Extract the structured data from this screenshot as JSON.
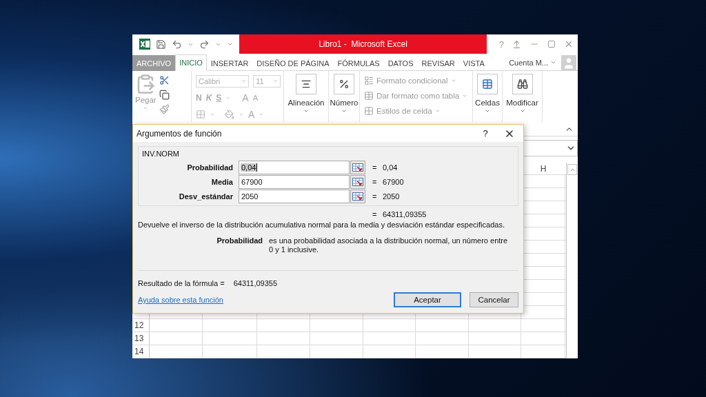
{
  "title_bar": {
    "title": "Libro1 -  Microsoft Excel",
    "help": "?"
  },
  "ribbon_tabs": [
    {
      "label": "ARCHIVO",
      "selected": false,
      "kind": "file"
    },
    {
      "label": "INICIO",
      "selected": true,
      "kind": "tab"
    },
    {
      "label": "INSERTAR",
      "selected": false,
      "kind": "tab"
    },
    {
      "label": "DISEÑO DE PÁGINA",
      "selected": false,
      "kind": "tab"
    },
    {
      "label": "FÓRMULAS",
      "selected": false,
      "kind": "tab"
    },
    {
      "label": "DATOS",
      "selected": false,
      "kind": "tab"
    },
    {
      "label": "REVISAR",
      "selected": false,
      "kind": "tab"
    },
    {
      "label": "VISTA",
      "selected": false,
      "kind": "tab"
    }
  ],
  "account": {
    "label": "Cuenta M..."
  },
  "ribbon": {
    "clipboard": {
      "paste": "Pegar"
    },
    "font": {
      "disabled": true,
      "name": "Calibri",
      "size": "11",
      "bold": "N",
      "italic": "K",
      "underline": "S",
      "grow": "A",
      "shrink": "A",
      "font_color_label": "A"
    },
    "big_buttons": [
      {
        "label": "Alineación",
        "kind": "align"
      },
      {
        "label": "Número",
        "kind": "number"
      }
    ],
    "styles": {
      "disabled": true,
      "items": [
        {
          "label": "Formato condicional",
          "kind": "conditional"
        },
        {
          "label": "Dar formato como tabla",
          "kind": "table"
        },
        {
          "label": "Estilos de celda",
          "kind": "cellstyle"
        }
      ]
    },
    "cells_buttons": [
      {
        "label": "Celdas",
        "kind": "cells"
      },
      {
        "label": "Modificar",
        "kind": "find"
      }
    ]
  },
  "sheet": {
    "column_header": "H",
    "row_numbers": [
      "12",
      "13",
      "14"
    ]
  },
  "dialog": {
    "title": "Argumentos de función",
    "help": "?",
    "function_name": "INV.NORM",
    "arguments": [
      {
        "label": "Probabilidad",
        "value": "0,04",
        "equals": "=",
        "result": "0,04",
        "selected": true
      },
      {
        "label": "Media",
        "value": "67900",
        "equals": "=",
        "result": "67900",
        "selected": false
      },
      {
        "label": "Desv_estándar",
        "value": "2050",
        "equals": "=",
        "result": "2050",
        "selected": false
      }
    ],
    "total": {
      "equals": "=",
      "value": "64311,09355"
    },
    "description": "Devuelve el inverso de la distribución acumulativa normal para la media y desviación estándar especificadas.",
    "argument_help": {
      "name": "Probabilidad",
      "text": "es una probabilidad asociada a la distribución normal, un número entre 0 y 1 inclusive."
    },
    "result_label": "Resultado de la fórmula =",
    "result_value": "64311,09355",
    "help_link": "Ayuda sobre esta función",
    "buttons": [
      {
        "label": "Aceptar",
        "default": true
      },
      {
        "label": "Cancelar",
        "default": false
      }
    ]
  }
}
